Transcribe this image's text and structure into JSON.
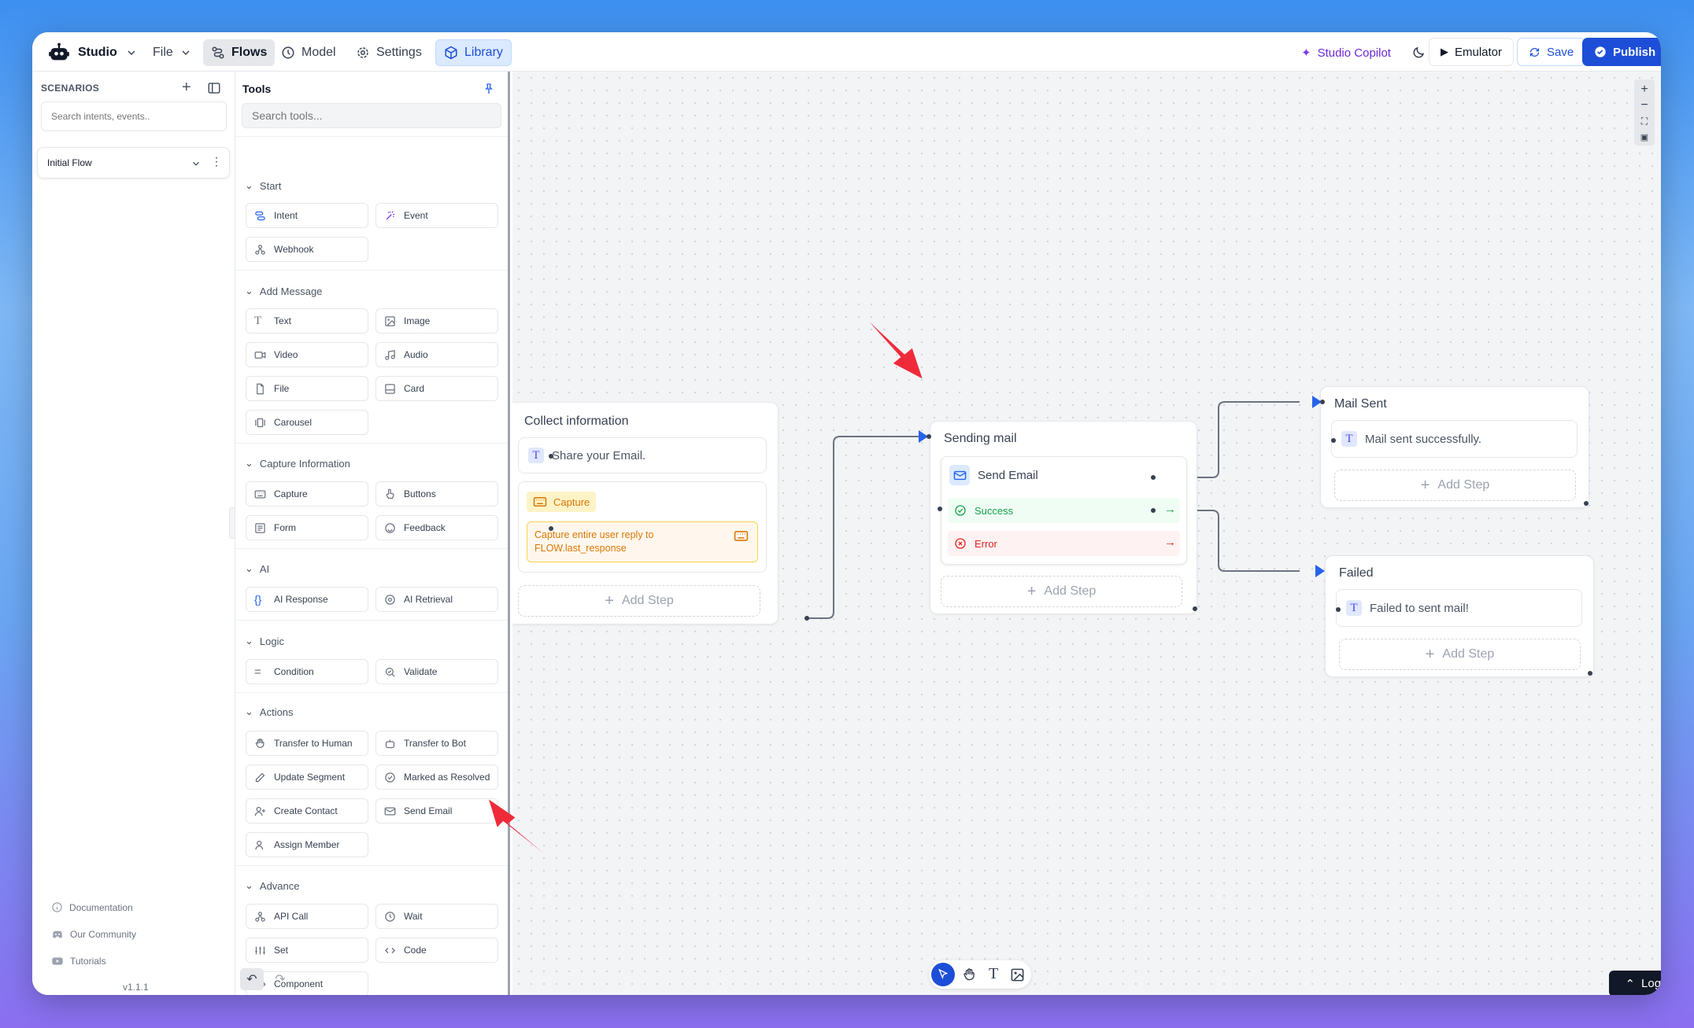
{
  "topbar": {
    "app_name": "Studio",
    "file": "File",
    "flows": "Flows",
    "model": "Model",
    "settings": "Settings",
    "library": "Library",
    "copilot": "Studio Copilot",
    "emulator": "Emulator",
    "save": "Save",
    "publish": "Publish"
  },
  "sidebar": {
    "heading": "SCENARIOS",
    "search_placeholder": "Search intents, events..",
    "flow_name": "Initial Flow",
    "footer": [
      "Documentation",
      "Our Community",
      "Tutorials"
    ],
    "version": "v1.1.1"
  },
  "tools": {
    "title": "Tools",
    "search_placeholder": "Search tools...",
    "sections": {
      "start": {
        "label": "Start",
        "items": [
          "Intent",
          "Event",
          "Webhook"
        ]
      },
      "message": {
        "label": "Add Message",
        "items": [
          "Text",
          "Image",
          "Video",
          "Audio",
          "File",
          "Card",
          "Carousel"
        ]
      },
      "capture": {
        "label": "Capture Information",
        "items": [
          "Capture",
          "Buttons",
          "Form",
          "Feedback"
        ]
      },
      "ai": {
        "label": "AI",
        "items": [
          "AI Response",
          "AI Retrieval"
        ]
      },
      "logic": {
        "label": "Logic",
        "items": [
          "Condition",
          "Validate"
        ]
      },
      "actions": {
        "label": "Actions",
        "items": [
          "Transfer to Human",
          "Transfer to Bot",
          "Update Segment",
          "Marked as Resolved",
          "Create Contact",
          "Send Email",
          "Assign Member"
        ]
      },
      "advance": {
        "label": "Advance",
        "items": [
          "API Call",
          "Wait",
          "Set",
          "Code",
          "Component"
        ]
      }
    }
  },
  "canvas": {
    "collect": {
      "title": "Collect information",
      "text": "Share your Email.",
      "capture_label": "Capture",
      "capture_desc_1": "Capture entire user reply to",
      "capture_desc_2": "FLOW.last_response",
      "add_step": "Add Step"
    },
    "sending": {
      "title": "Sending mail",
      "step": "Send Email",
      "success": "Success",
      "error": "Error",
      "add_step": "Add Step"
    },
    "sent": {
      "title": "Mail Sent",
      "text": "Mail sent successfully.",
      "add_step": "Add Step"
    },
    "failed": {
      "title": "Failed",
      "text": "Failed to sent mail!",
      "add_step": "Add Step"
    },
    "logs": "Logs"
  },
  "colors": {
    "accent": "#1d4ed8",
    "success": "#16a34a",
    "error": "#dc2626",
    "capture": "#f59e0b",
    "copilot": "#7c3aed",
    "annotation": "#ef2b3a"
  }
}
